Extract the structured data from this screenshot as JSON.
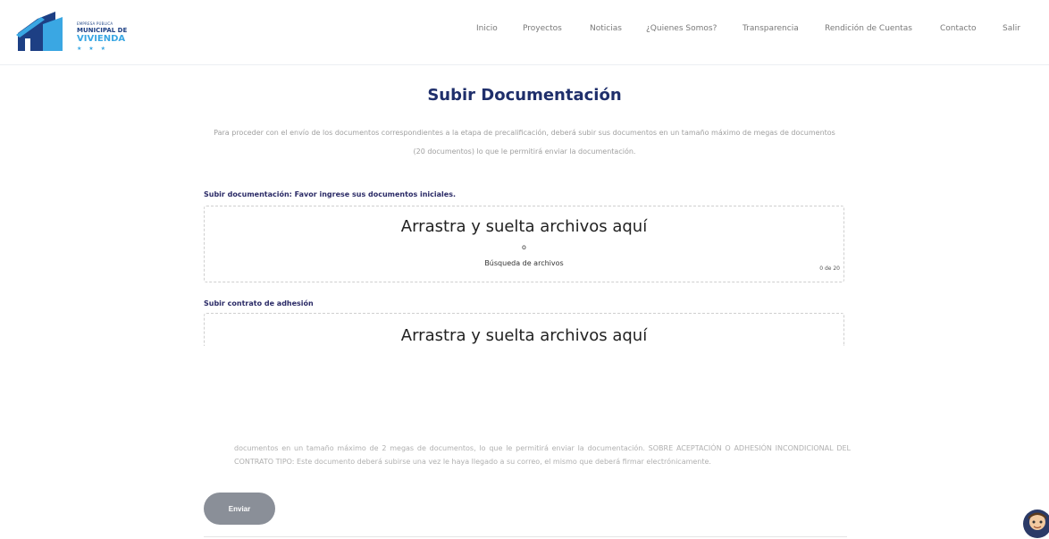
{
  "header": {
    "logo": {
      "line1": "EMPRESA PÚBLICA",
      "line2": "MUNICIPAL DE",
      "line3": "VIVIENDA",
      "stars": "★ ★ ★"
    },
    "nav": [
      {
        "label": "Inicio"
      },
      {
        "label": "Proyectos"
      },
      {
        "label": "Noticias"
      },
      {
        "label": "¿Quienes Somos?"
      },
      {
        "label": "Transparencia"
      },
      {
        "label": "Rendición de Cuentas"
      },
      {
        "label": "Contacto"
      },
      {
        "label": "Salir"
      }
    ]
  },
  "main": {
    "title": "Subir Documentación",
    "intro": "Para proceder con el envío de los documentos correspondientes a la etapa de precalificación, deberá subir sus documentos en un tamaño máximo de    megas de documentos (20 documentos) lo que le permitirá enviar la documentación.",
    "upload1": {
      "label": "Subir documentación: Favor ingrese sus documentos iniciales.",
      "drop_text": "Arrastra y suelta archivos aquí",
      "or_text": "o",
      "browse_text": "Búsqueda de archivos",
      "count": "0 de 20"
    },
    "upload2": {
      "label": "Subir contrato de adhesión",
      "drop_text": "Arrastra y suelta archivos aquí"
    },
    "note": "documentos en un tamaño máximo de 2 megas de documentos, lo que le permitirá enviar la documentación. SOBRE ACEPTACIÓN O ADHESIÓN INCONDICIONAL DEL CONTRATO TIPO: Este documento deberá subirse una vez le haya llegado a su correo, el mismo que deberá firmar electrónicamente.",
    "submit_label": "Enviar"
  },
  "colors": {
    "title": "#1f2f6b",
    "logo_dark": "#1d3f84",
    "logo_light": "#3aa7e3",
    "button": "#8a8f98"
  },
  "icons": {
    "logo": "building-logo-icon",
    "chat": "chat-assistant-avatar-icon"
  }
}
